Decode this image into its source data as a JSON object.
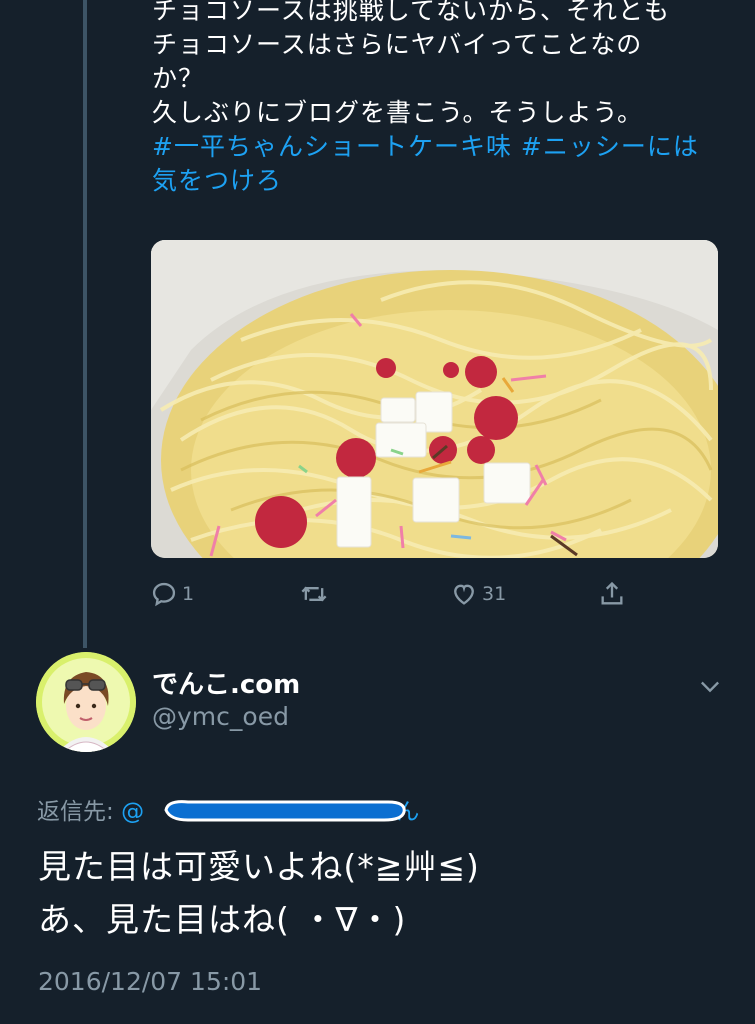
{
  "parent_tweet": {
    "text_lines": [
      "チョコソースは挑戦してないから、それとも",
      "チョコソースはさらにヤバイってことなの",
      "か？",
      "久しぶりにブログを書こう。そうしよう。"
    ],
    "hashtag_lines": [
      "#一平ちゃんショートケーキ味 #ニッシーには",
      "気をつけろ"
    ],
    "actions": {
      "reply_count": "1",
      "retweet_count": "",
      "like_count": "31"
    },
    "image_icon": "noodle-photo"
  },
  "reply_tweet": {
    "display_name": "でんこ.com",
    "handle": "@ymc_oed",
    "reply_to_label": "返信先:",
    "reply_to_prefix": "@",
    "reply_to_suffix": "さん",
    "text_lines": [
      "見た目は可愛いよね(*≧艸≦)",
      "あ、見た目はね( ・∇・)"
    ],
    "timestamp": "2016/12/07 15:01"
  },
  "colors": {
    "background": "#15202b",
    "accent": "#1da1f2",
    "muted": "#8899a6",
    "thread_line": "#3d5466"
  }
}
